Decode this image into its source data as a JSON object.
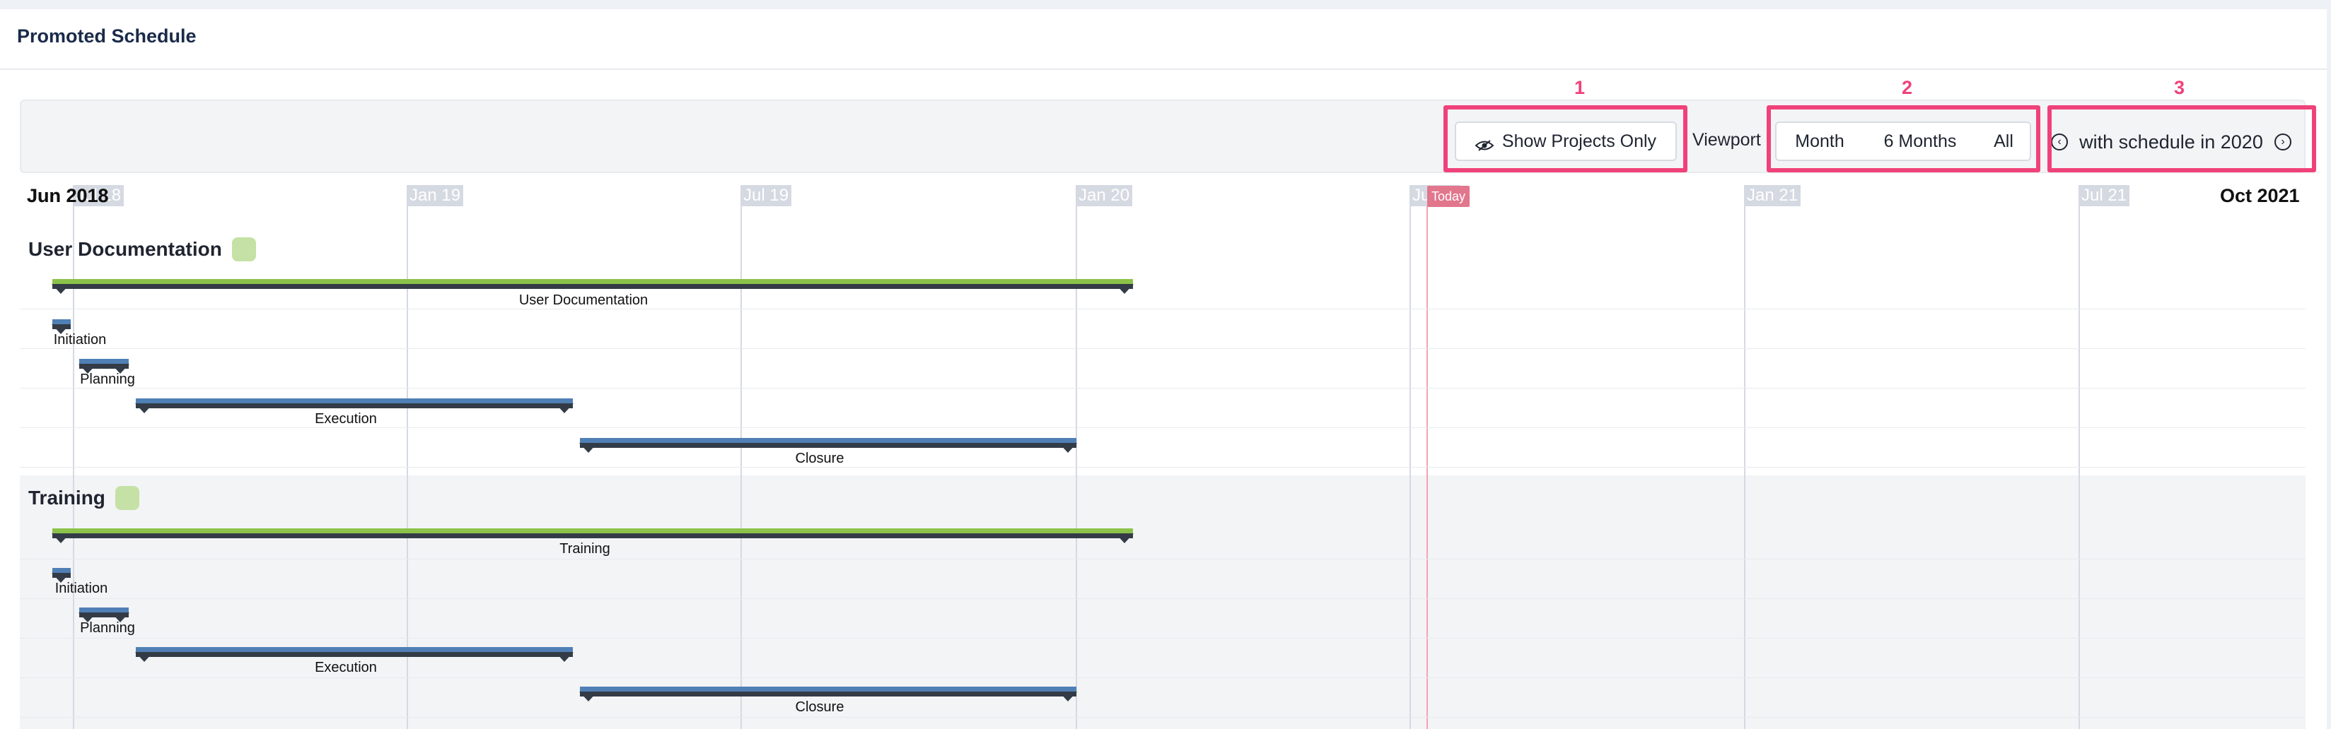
{
  "page_title": "Promoted Schedule",
  "toolbar": {
    "show_projects_only": "Show Projects Only",
    "viewport_label": "Viewport",
    "viewport_options": [
      "Month",
      "6 Months",
      "All"
    ],
    "schedule_label": "with schedule in 2020",
    "annotations": [
      "1",
      "2",
      "3"
    ]
  },
  "timeline": {
    "start_label": "Jun 2018",
    "end_label": "Oct 2021",
    "ticks": [
      "Jul 18",
      "Jan 19",
      "Jul 19",
      "Jan 20",
      "Jul 20",
      "Jan 21",
      "Jul 21"
    ],
    "today_label": "Today",
    "today_date": "2020-07"
  },
  "groups": [
    {
      "name": "User Documentation",
      "swatch_color": "#c5e1a5",
      "tasks": [
        {
          "label": "User Documentation",
          "type": "project",
          "start": "2018-06",
          "end": "2020-01"
        },
        {
          "label": "Initiation",
          "type": "phase",
          "start": "2018-06",
          "end": "2018-06"
        },
        {
          "label": "Planning",
          "type": "phase",
          "start": "2018-07",
          "end": "2018-08"
        },
        {
          "label": "Execution",
          "type": "phase",
          "start": "2018-09",
          "end": "2019-05"
        },
        {
          "label": "Closure",
          "type": "phase",
          "start": "2019-05",
          "end": "2020-01"
        }
      ]
    },
    {
      "name": "Training",
      "swatch_color": "#c5e1a5",
      "tasks": [
        {
          "label": "Training",
          "type": "project",
          "start": "2018-06",
          "end": "2020-01"
        },
        {
          "label": "Initiation",
          "type": "phase",
          "start": "2018-06",
          "end": "2018-06"
        },
        {
          "label": "Planning",
          "type": "phase",
          "start": "2018-07",
          "end": "2018-08"
        },
        {
          "label": "Execution",
          "type": "phase",
          "start": "2018-09",
          "end": "2019-05"
        },
        {
          "label": "Closure",
          "type": "phase",
          "start": "2019-05",
          "end": "2020-01"
        }
      ]
    }
  ],
  "colors": {
    "project_bar": "#8bc34a",
    "phase_bar": "#4f7fb5",
    "highlight": "#f0427a",
    "today": "#e2768c"
  }
}
